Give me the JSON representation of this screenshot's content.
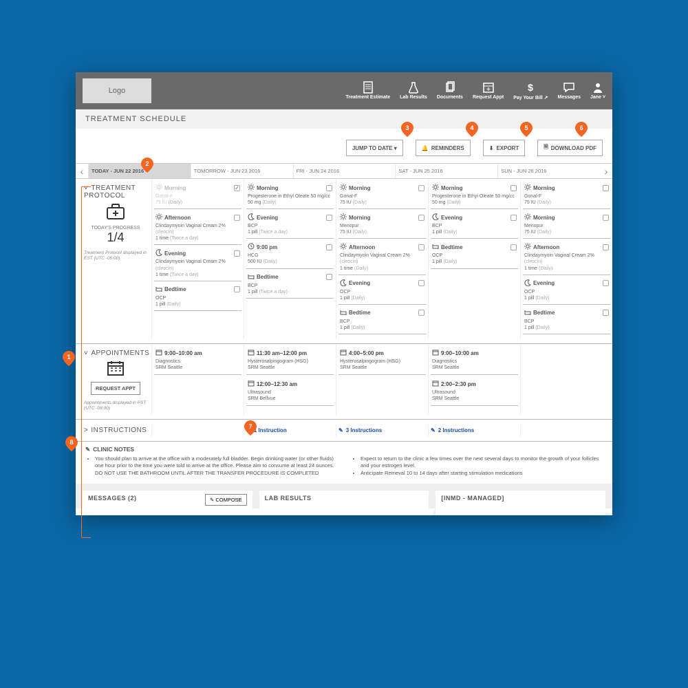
{
  "header": {
    "logo_text": "Logo",
    "nav": [
      {
        "label": "Treatment Estimate",
        "icon": "doc"
      },
      {
        "label": "Lab Results",
        "icon": "flask"
      },
      {
        "label": "Documents",
        "icon": "files"
      },
      {
        "label": "Request Appt",
        "icon": "calendar-plus"
      },
      {
        "label": "Pay Your Bill ↗",
        "icon": "dollar"
      },
      {
        "label": "Messages",
        "icon": "chat"
      },
      {
        "label": "Jane ˅",
        "icon": "user"
      }
    ]
  },
  "page_title": "TREATMENT SCHEDULE",
  "toolbar": {
    "jump_label": "JUMP TO DATE ▾",
    "reminders_label": "REMINDERS",
    "export_label": "EXPORT",
    "download_label": "DOWNLOAD PDF"
  },
  "annotations": {
    "pin1": "1",
    "pin2": "2",
    "pin3": "3",
    "pin4": "4",
    "pin5": "5",
    "pin6": "6",
    "pin7": "7",
    "pin8": "8"
  },
  "days": [
    {
      "label": "TODAY - JUN 22 2016",
      "today": true
    },
    {
      "label": "TOMORROW - JUN 23 2016"
    },
    {
      "label": "FRI - JUN 24 2016"
    },
    {
      "label": "SAT - JUN 25 2016"
    },
    {
      "label": "SUN - JUN 26 2016"
    }
  ],
  "protocol": {
    "section_title": "TREATMENT PROTOCOL",
    "progress_label": "TODAY'S PROGRESS",
    "progress_value": "1/4",
    "tz_note": "Treatment Protocol displayed in EST (UTC -05:00)",
    "columns": [
      [
        {
          "time": "Morning",
          "dim": true,
          "done": true,
          "lines": [
            "Gonal-F",
            "75 IU (Daily)"
          ]
        },
        {
          "time": "Afternoon",
          "lines": [
            "Clindaymyoin Vaginal Cream 2% (cleocin)",
            "1 time (Twice a day)"
          ]
        },
        {
          "time": "Evening",
          "lines": [
            "Clindaymyoin Vaginal Cream 2% (cleocin)",
            "1 time (Twice a day)"
          ]
        },
        {
          "time": "Bedtime",
          "lines": [
            "OCP",
            "1 pill (Daily)"
          ]
        }
      ],
      [
        {
          "time": "Morning",
          "lines": [
            "Progesterone in Ethyl Oleate 50 mg/cc",
            "50 mg (Daily)"
          ]
        },
        {
          "time": "Evening",
          "lines": [
            "BCP",
            "1 pill (Twice a day)"
          ]
        },
        {
          "time": "9:00 pm",
          "lines": [
            "HCG",
            "500 IU (Daily)"
          ]
        },
        {
          "time": "Bedtime",
          "lines": [
            "BCP",
            "1 pill (Twice a day)"
          ]
        }
      ],
      [
        {
          "time": "Morning",
          "lines": [
            "Gonal-F",
            "75 IU (Daily)"
          ]
        },
        {
          "time": "Morning",
          "lines": [
            "Menopur",
            "75 IU (Daily)"
          ]
        },
        {
          "time": "Afternoon",
          "lines": [
            "Clindaymyoin Vaginal Cream 2% (cleocin)",
            "1 time (Daily)"
          ]
        },
        {
          "time": "Evening",
          "lines": [
            "OCP",
            "1 pill (Daily)"
          ]
        },
        {
          "time": "Bedtime",
          "lines": [
            "BCP",
            "1 pill (Daily)"
          ]
        }
      ],
      [
        {
          "time": "Morning",
          "lines": [
            "Progesterone in Ethyl Oleate 50 mg/cc",
            "50 mg (Daily)"
          ]
        },
        {
          "time": "Evening",
          "lines": [
            "BCP",
            "1 pill (Daily)"
          ]
        },
        {
          "time": "Bedtime",
          "lines": [
            "OCP",
            "1 pill (Daily)"
          ]
        }
      ],
      [
        {
          "time": "Morning",
          "lines": [
            "Gonal-F",
            "75 IU (Daily)"
          ]
        },
        {
          "time": "Morning",
          "lines": [
            "Menopur",
            "75 IU (Daily)"
          ]
        },
        {
          "time": "Afternoon",
          "lines": [
            "Clindaymyoin Vaginal Cream 2% (cleocin)",
            "1 time (Daily)"
          ]
        },
        {
          "time": "Evening",
          "lines": [
            "OCP",
            "1 pill (Daily)"
          ]
        },
        {
          "time": "Bedtime",
          "lines": [
            "BCP",
            "1 pill (Daily)"
          ]
        }
      ]
    ]
  },
  "appointments": {
    "section_title": "APPOINTMENTS",
    "request_label": "REQUEST APPT",
    "tz_note": "Appointments displayed in PST (UTC -08:00)",
    "columns": [
      [
        {
          "time": "9:00–10:00 am",
          "lines": [
            "Diagnostics",
            "SRM Seattle"
          ]
        }
      ],
      [
        {
          "time": "11:30 am–12:00 pm",
          "lines": [
            "Hysterosalpingogram (HSG)",
            "SRM Seattle"
          ]
        },
        {
          "time": "12:00–12:30 am",
          "lines": [
            "Ultrasound",
            "SRM Bellvue"
          ]
        }
      ],
      [
        {
          "time": "4:00–5:00 pm",
          "lines": [
            "Hysterosalpingogram (HSG)",
            "SRM Seattle"
          ]
        }
      ],
      [
        {
          "time": "9:00–10:00 am",
          "lines": [
            "Diagnostics",
            "SRM Seattle"
          ]
        },
        {
          "time": "2:00–2:30 pm",
          "lines": [
            "Ultrasound",
            "SRM Seattle"
          ]
        }
      ],
      []
    ]
  },
  "instructions": {
    "section_title": "INSTRUCTIONS",
    "columns": [
      "",
      "1 Instruction",
      "3 Instructions",
      "2 Instructions",
      ""
    ]
  },
  "clinic_notes": {
    "title": "CLINIC NOTES",
    "left": [
      "You should plan to arrive at the office with a moderately full bladder. Begin drinking water (or other fluids) one hour prior to the time you were told to arrive at the office.  Please aim to consume at least 24 ounces. DO NOT USE THE BATHROOM UNTIL AFTER THE TRANSFER PROCEDURE IS COMPLETED"
    ],
    "right": [
      "Expect to return to the clinic a few times over the next several days to monitor the growth of your follicles and your estrogen level.",
      "Anticipate Retrieval 10 to 14 days after starting stimulation medications"
    ]
  },
  "bottom_panels": {
    "messages_title": "MESSAGES (2)",
    "compose_label": "✎ COMPOSE",
    "lab_title": "LAB RESULTS",
    "inmd_title": "[INMD - MANAGED]"
  }
}
